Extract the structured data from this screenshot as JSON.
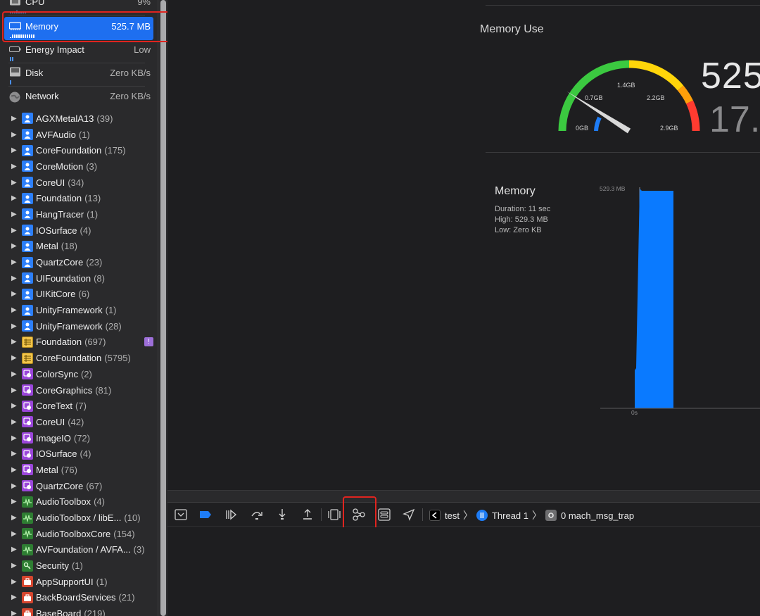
{
  "gauges": [
    {
      "label": "CPU",
      "value": "9%",
      "icon": "cpu-icon"
    },
    {
      "label": "Memory",
      "value": "525.7 MB",
      "icon": "memory-chip-icon",
      "selected": true
    },
    {
      "label": "Energy Impact",
      "value": "Low",
      "icon": "battery-icon"
    },
    {
      "label": "Disk",
      "value": "Zero KB/s",
      "icon": "disk-icon"
    },
    {
      "label": "Network",
      "value": "Zero KB/s",
      "icon": "globe-icon"
    }
  ],
  "libraries": [
    {
      "name": "AGXMetalA13",
      "count": "(39)",
      "icon": "user"
    },
    {
      "name": "AVFAudio",
      "count": "(1)",
      "icon": "user"
    },
    {
      "name": "CoreFoundation",
      "count": "(175)",
      "icon": "user"
    },
    {
      "name": "CoreMotion",
      "count": "(3)",
      "icon": "user"
    },
    {
      "name": "CoreUI",
      "count": "(34)",
      "icon": "user"
    },
    {
      "name": "Foundation",
      "count": "(13)",
      "icon": "user"
    },
    {
      "name": "HangTracer",
      "count": "(1)",
      "icon": "user"
    },
    {
      "name": "IOSurface",
      "count": "(4)",
      "icon": "user"
    },
    {
      "name": "Metal",
      "count": "(18)",
      "icon": "user"
    },
    {
      "name": "QuartzCore",
      "count": "(23)",
      "icon": "user"
    },
    {
      "name": "UIFoundation",
      "count": "(8)",
      "icon": "user"
    },
    {
      "name": "UIKitCore",
      "count": "(6)",
      "icon": "user"
    },
    {
      "name": "UnityFramework",
      "count": "(1)",
      "icon": "user"
    },
    {
      "name": "UnityFramework",
      "count": "(28)",
      "icon": "user"
    },
    {
      "name": "Foundation",
      "count": "(697)",
      "icon": "table",
      "badge": "!"
    },
    {
      "name": "CoreFoundation",
      "count": "(5795)",
      "icon": "table"
    },
    {
      "name": "ColorSync",
      "count": "(2)",
      "icon": "color"
    },
    {
      "name": "CoreGraphics",
      "count": "(81)",
      "icon": "color"
    },
    {
      "name": "CoreText",
      "count": "(7)",
      "icon": "color"
    },
    {
      "name": "CoreUI",
      "count": "(42)",
      "icon": "color"
    },
    {
      "name": "ImageIO",
      "count": "(72)",
      "icon": "color"
    },
    {
      "name": "IOSurface",
      "count": "(4)",
      "icon": "color"
    },
    {
      "name": "Metal",
      "count": "(76)",
      "icon": "color"
    },
    {
      "name": "QuartzCore",
      "count": "(67)",
      "icon": "color"
    },
    {
      "name": "AudioToolbox",
      "count": "(4)",
      "icon": "audio"
    },
    {
      "name": "AudioToolbox / libE...",
      "count": "(10)",
      "icon": "audio"
    },
    {
      "name": "AudioToolboxCore",
      "count": "(154)",
      "icon": "audio"
    },
    {
      "name": "AVFoundation / AVFA...",
      "count": "(3)",
      "icon": "audio"
    },
    {
      "name": "Security",
      "count": "(1)",
      "icon": "sec"
    },
    {
      "name": "AppSupportUI",
      "count": "(1)",
      "icon": "brief"
    },
    {
      "name": "BackBoardServices",
      "count": "(21)",
      "icon": "brief"
    },
    {
      "name": "BaseBoard",
      "count": "(219)",
      "icon": "brief"
    }
  ],
  "memory_use": {
    "title": "Memory Use",
    "gauge_labels": [
      "0GB",
      "0.7GB",
      "1.4GB",
      "2.2GB",
      "2.9GB"
    ],
    "needle_fraction": 0.18,
    "big_value": "525",
    "big_value2": "17.",
    "colors": {
      "green": "#3bc940",
      "yellow": "#ffd60a",
      "red": "#ff3b30",
      "blue": "#1e7cf5"
    }
  },
  "memory_report": {
    "title": "Memory",
    "duration": "Duration: 11 sec",
    "high": "High: 529.3 MB",
    "low": "Low: Zero KB",
    "y_label": "529.3 MB",
    "x_label": "0s"
  },
  "toolbar": {
    "buttons": [
      "hide-debug-area-icon",
      "breakpoints-toggle-icon",
      "continue-icon",
      "step-over-icon",
      "step-into-icon",
      "step-out-icon",
      "debug-view-hierarchy-icon",
      "debug-memory-graph-icon",
      "environment-overrides-icon",
      "simulate-location-icon"
    ],
    "breadcrumb": {
      "app": "test",
      "thread": "Thread 1",
      "frame": "0 mach_msg_trap"
    }
  }
}
